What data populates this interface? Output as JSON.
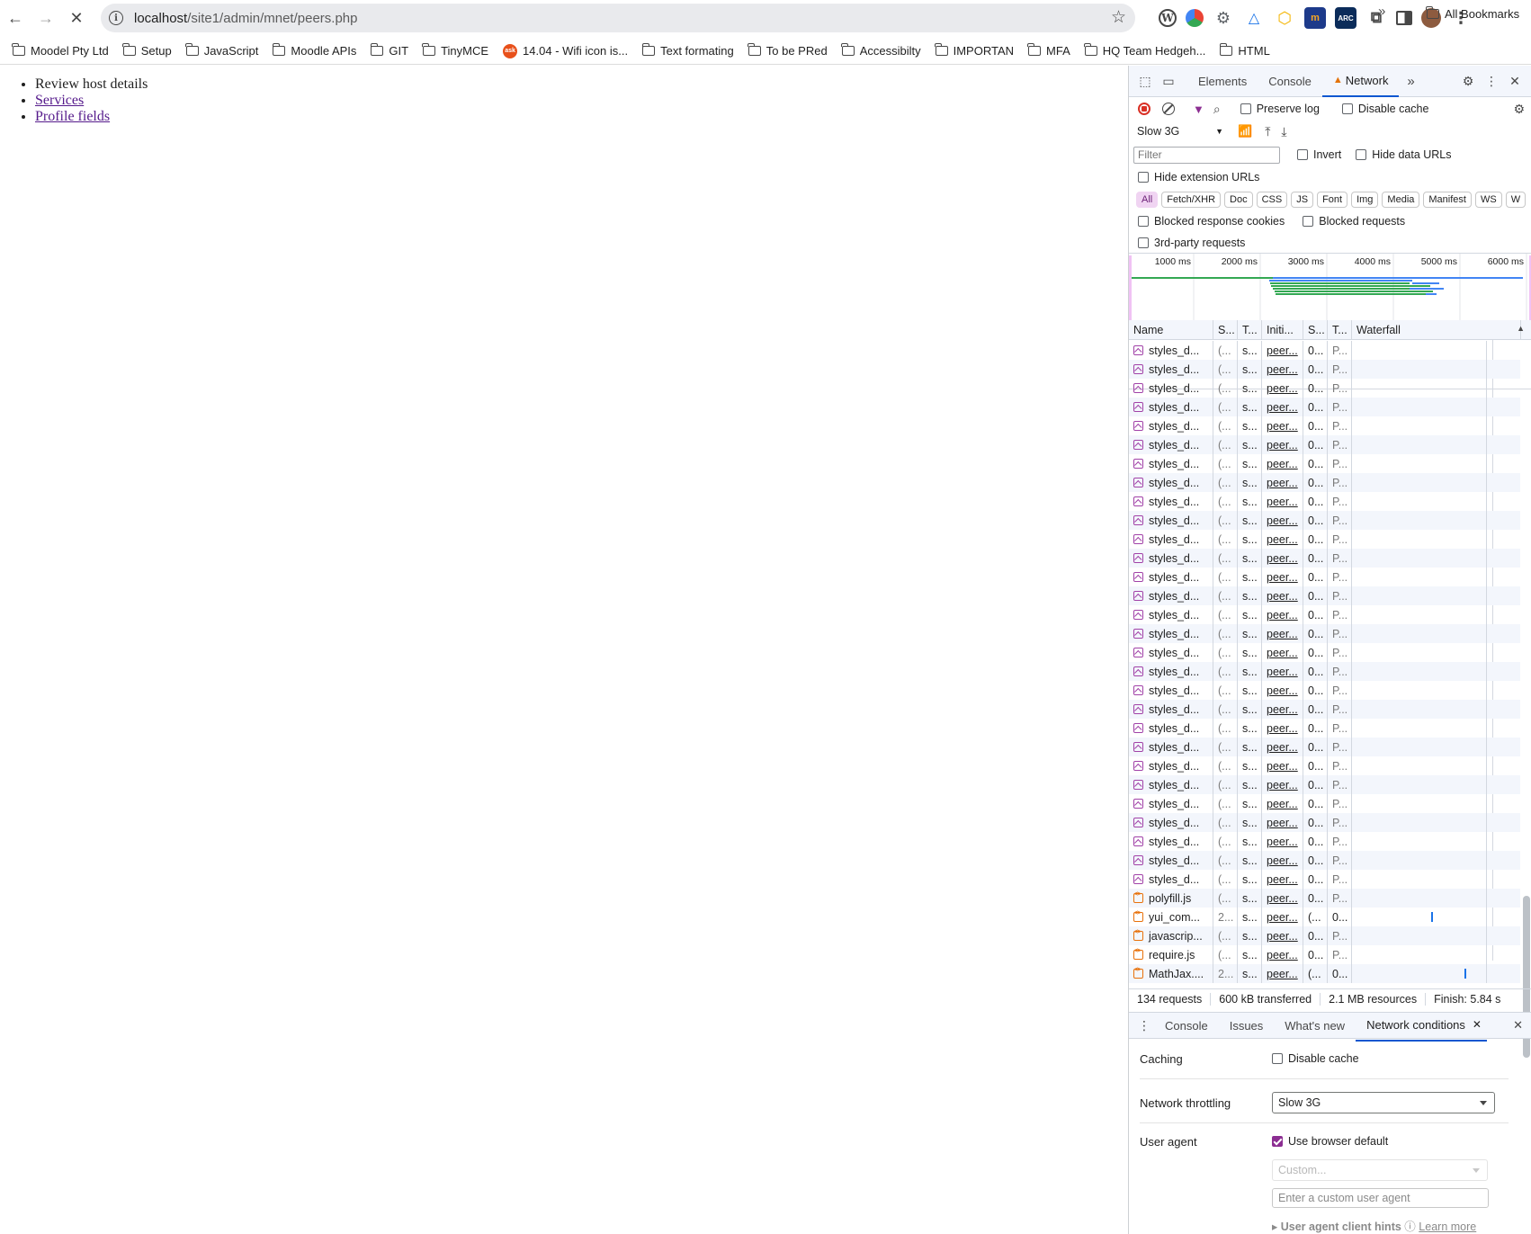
{
  "browser": {
    "url_host": "localhost",
    "url_path": "/site1/admin/mnet/peers.php",
    "extensions": [
      "wordpress-icon",
      "colorwheel-icon",
      "gear-wheel-icon",
      "vector-icon",
      "hexagon-icon",
      "moodle-icon",
      "arc-icon",
      "puzzle-icon",
      "sidepanel-icon",
      "avatar",
      "kebab-menu-icon"
    ],
    "bookmarks": [
      {
        "label": "Moodel Pty Ltd",
        "type": "folder"
      },
      {
        "label": "Setup",
        "type": "folder"
      },
      {
        "label": "JavaScript",
        "type": "folder"
      },
      {
        "label": "Moodle APIs",
        "type": "folder"
      },
      {
        "label": "GIT",
        "type": "folder"
      },
      {
        "label": "TinyMCE",
        "type": "folder"
      },
      {
        "label": "14.04 - Wifi icon is...",
        "type": "ask"
      },
      {
        "label": "Text formating",
        "type": "folder"
      },
      {
        "label": "To be PRed",
        "type": "folder"
      },
      {
        "label": "Accessibilty",
        "type": "folder"
      },
      {
        "label": "IMPORTAN",
        "type": "folder"
      },
      {
        "label": "MFA",
        "type": "folder"
      },
      {
        "label": "HQ Team Hedgeh...",
        "type": "folder"
      },
      {
        "label": "HTML",
        "type": "folder"
      }
    ],
    "all_bookmarks": "All Bookmarks"
  },
  "page": {
    "items": [
      {
        "label": "Review host details",
        "link": false
      },
      {
        "label": "Services",
        "link": true
      },
      {
        "label": "Profile fields",
        "link": true
      }
    ]
  },
  "devtools": {
    "tabs": [
      "Elements",
      "Console",
      "Network"
    ],
    "active_tab": "Network",
    "preserve_log": "Preserve log",
    "disable_cache": "Disable cache",
    "throttle": "Slow 3G",
    "filter_placeholder": "Filter",
    "invert": "Invert",
    "hide_data_urls": "Hide data URLs",
    "hide_extension_urls": "Hide extension URLs",
    "type_filters": [
      "All",
      "Fetch/XHR",
      "Doc",
      "CSS",
      "JS",
      "Font",
      "Img",
      "Media",
      "Manifest",
      "WS",
      "W"
    ],
    "blocked_response_cookies": "Blocked response cookies",
    "blocked_requests": "Blocked requests",
    "third_party": "3rd-party requests",
    "timeline_ticks": [
      "1000 ms",
      "2000 ms",
      "3000 ms",
      "4000 ms",
      "5000 ms",
      "6000 ms"
    ],
    "columns": [
      "Name",
      "S...",
      "T...",
      "Initi...",
      "S...",
      "T...",
      "Waterfall"
    ],
    "rows": [
      {
        "name": "styles_d...",
        "icon": "css",
        "s": "(...",
        "t": "s...",
        "init": "peer...",
        "s2": "0...",
        "t2": "P..."
      },
      {
        "name": "styles_d...",
        "icon": "css",
        "s": "(...",
        "t": "s...",
        "init": "peer...",
        "s2": "0...",
        "t2": "P..."
      },
      {
        "name": "styles_d...",
        "icon": "css",
        "s": "(...",
        "t": "s...",
        "init": "peer...",
        "s2": "0...",
        "t2": "P..."
      },
      {
        "name": "styles_d...",
        "icon": "css",
        "s": "(...",
        "t": "s...",
        "init": "peer...",
        "s2": "0...",
        "t2": "P..."
      },
      {
        "name": "styles_d...",
        "icon": "css",
        "s": "(...",
        "t": "s...",
        "init": "peer...",
        "s2": "0...",
        "t2": "P..."
      },
      {
        "name": "styles_d...",
        "icon": "css",
        "s": "(...",
        "t": "s...",
        "init": "peer...",
        "s2": "0...",
        "t2": "P..."
      },
      {
        "name": "styles_d...",
        "icon": "css",
        "s": "(...",
        "t": "s...",
        "init": "peer...",
        "s2": "0...",
        "t2": "P..."
      },
      {
        "name": "styles_d...",
        "icon": "css",
        "s": "(...",
        "t": "s...",
        "init": "peer...",
        "s2": "0...",
        "t2": "P..."
      },
      {
        "name": "styles_d...",
        "icon": "css",
        "s": "(...",
        "t": "s...",
        "init": "peer...",
        "s2": "0...",
        "t2": "P..."
      },
      {
        "name": "styles_d...",
        "icon": "css",
        "s": "(...",
        "t": "s...",
        "init": "peer...",
        "s2": "0...",
        "t2": "P..."
      },
      {
        "name": "styles_d...",
        "icon": "css",
        "s": "(...",
        "t": "s...",
        "init": "peer...",
        "s2": "0...",
        "t2": "P..."
      },
      {
        "name": "styles_d...",
        "icon": "css",
        "s": "(...",
        "t": "s...",
        "init": "peer...",
        "s2": "0...",
        "t2": "P..."
      },
      {
        "name": "styles_d...",
        "icon": "css",
        "s": "(...",
        "t": "s...",
        "init": "peer...",
        "s2": "0...",
        "t2": "P..."
      },
      {
        "name": "styles_d...",
        "icon": "css",
        "s": "(...",
        "t": "s...",
        "init": "peer...",
        "s2": "0...",
        "t2": "P..."
      },
      {
        "name": "styles_d...",
        "icon": "css",
        "s": "(...",
        "t": "s...",
        "init": "peer...",
        "s2": "0...",
        "t2": "P..."
      },
      {
        "name": "styles_d...",
        "icon": "css",
        "s": "(...",
        "t": "s...",
        "init": "peer...",
        "s2": "0...",
        "t2": "P..."
      },
      {
        "name": "styles_d...",
        "icon": "css",
        "s": "(...",
        "t": "s...",
        "init": "peer...",
        "s2": "0...",
        "t2": "P..."
      },
      {
        "name": "styles_d...",
        "icon": "css",
        "s": "(...",
        "t": "s...",
        "init": "peer...",
        "s2": "0...",
        "t2": "P..."
      },
      {
        "name": "styles_d...",
        "icon": "css",
        "s": "(...",
        "t": "s...",
        "init": "peer...",
        "s2": "0...",
        "t2": "P..."
      },
      {
        "name": "styles_d...",
        "icon": "css",
        "s": "(...",
        "t": "s...",
        "init": "peer...",
        "s2": "0...",
        "t2": "P..."
      },
      {
        "name": "styles_d...",
        "icon": "css",
        "s": "(...",
        "t": "s...",
        "init": "peer...",
        "s2": "0...",
        "t2": "P..."
      },
      {
        "name": "styles_d...",
        "icon": "css",
        "s": "(...",
        "t": "s...",
        "init": "peer...",
        "s2": "0...",
        "t2": "P..."
      },
      {
        "name": "styles_d...",
        "icon": "css",
        "s": "(...",
        "t": "s...",
        "init": "peer...",
        "s2": "0...",
        "t2": "P..."
      },
      {
        "name": "styles_d...",
        "icon": "css",
        "s": "(...",
        "t": "s...",
        "init": "peer...",
        "s2": "0...",
        "t2": "P..."
      },
      {
        "name": "styles_d...",
        "icon": "css",
        "s": "(...",
        "t": "s...",
        "init": "peer...",
        "s2": "0...",
        "t2": "P..."
      },
      {
        "name": "styles_d...",
        "icon": "css",
        "s": "(...",
        "t": "s...",
        "init": "peer...",
        "s2": "0...",
        "t2": "P..."
      },
      {
        "name": "styles_d...",
        "icon": "css",
        "s": "(...",
        "t": "s...",
        "init": "peer...",
        "s2": "0...",
        "t2": "P..."
      },
      {
        "name": "styles_d...",
        "icon": "css",
        "s": "(...",
        "t": "s...",
        "init": "peer...",
        "s2": "0...",
        "t2": "P..."
      },
      {
        "name": "styles_d...",
        "icon": "css",
        "s": "(...",
        "t": "s...",
        "init": "peer...",
        "s2": "0...",
        "t2": "P..."
      },
      {
        "name": "polyfill.js",
        "icon": "js",
        "s": "(...",
        "t": "s...",
        "init": "peer...",
        "s2": "0...",
        "t2": "P..."
      },
      {
        "name": "yui_com...",
        "icon": "js",
        "s": "2...",
        "t": "s...",
        "init": "peer...",
        "s2": "(...",
        "t2": "0...",
        "wf": true
      },
      {
        "name": "javascrip...",
        "icon": "js",
        "s": "(...",
        "t": "s...",
        "init": "peer...",
        "s2": "0...",
        "t2": "P..."
      },
      {
        "name": "require.js",
        "icon": "js",
        "s": "(...",
        "t": "s...",
        "init": "peer...",
        "s2": "0...",
        "t2": "P..."
      },
      {
        "name": "MathJax....",
        "icon": "js",
        "s": "2...",
        "t": "s...",
        "init": "peer...",
        "s2": "(...",
        "t2": "0...",
        "wf": true
      }
    ],
    "summary": {
      "requests": "134 requests",
      "transferred": "600 kB transferred",
      "resources": "2.1 MB resources",
      "finish": "Finish: 5.84 s"
    },
    "drawer_tabs": [
      "Console",
      "Issues",
      "What's new",
      "Network conditions"
    ],
    "network_conditions": {
      "caching_label": "Caching",
      "disable_cache": "Disable cache",
      "throttling_label": "Network throttling",
      "throttling_value": "Slow 3G",
      "user_agent_label": "User agent",
      "use_browser_default": "Use browser default",
      "custom_placeholder": "Custom...",
      "custom_ua_placeholder": "Enter a custom user agent",
      "client_hints": "User agent client hints",
      "learn_more": "Learn more"
    }
  }
}
